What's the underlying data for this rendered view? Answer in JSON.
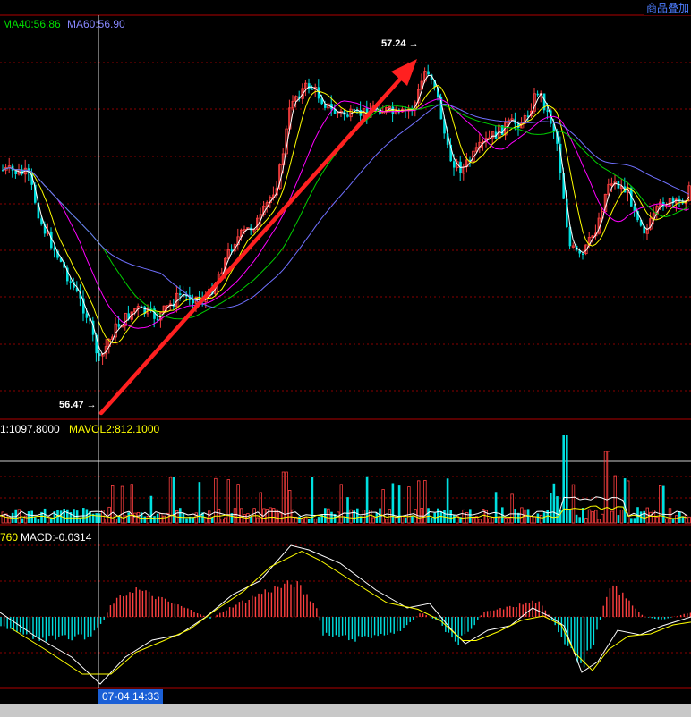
{
  "header": {
    "corner_label": "商品叠加",
    "ma_labels": [
      {
        "text": "MA40:56.86",
        "color": "#00e000"
      },
      {
        "text": "MA60:56.90",
        "color": "#8888ff"
      }
    ]
  },
  "volume_panel": {
    "labels": [
      {
        "text": "1:1097.8000",
        "color": "#ffffff"
      },
      {
        "text": "MAVOL2:812.1000",
        "color": "#ffff00"
      }
    ]
  },
  "macd_panel": {
    "labels": [
      {
        "text": "760",
        "color": "#ffff00"
      },
      {
        "text": "MACD:-0.0314",
        "color": "#ffffff"
      }
    ]
  },
  "annotations": {
    "high_label": "57.24",
    "low_label": "56.47",
    "cursor_time": "07-04 14:33"
  },
  "colors": {
    "up": "#ff4040",
    "down": "#00e0e0",
    "grid": "#8a0000",
    "arrow": "#ff2020",
    "ma_fast": "#ffffff",
    "ma_yellow": "#ffff00",
    "ma_magenta": "#ff00ff",
    "ma_green": "#00d000",
    "ma_blue": "#7070ff"
  },
  "chart_data": [
    {
      "type": "candlestick",
      "price_max": 57.24,
      "price_min": 56.47,
      "series": [
        {
          "name": "MA40",
          "value": 56.86
        },
        {
          "name": "MA60",
          "value": 56.9
        }
      ],
      "trend_arrow": {
        "from": 56.47,
        "to": 57.24
      }
    },
    {
      "type": "bar",
      "series": [
        {
          "name": "VOL",
          "value": 1097.8
        },
        {
          "name": "MAVOL2",
          "value": 812.1
        }
      ]
    },
    {
      "type": "bar",
      "series": [
        {
          "name": "MACD",
          "value": -0.0314
        }
      ]
    }
  ]
}
